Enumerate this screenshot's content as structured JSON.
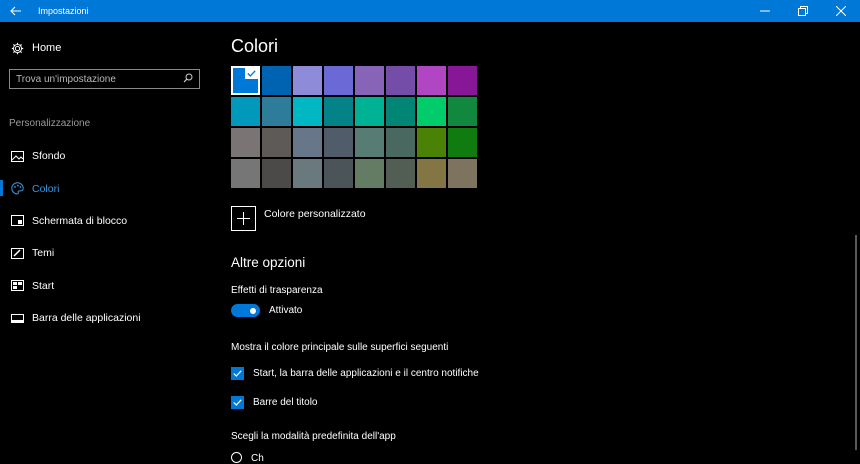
{
  "window": {
    "title": "Impostazioni"
  },
  "sidebar": {
    "home_label": "Home",
    "search_placeholder": "Trova un'impostazione",
    "section_label": "Personalizzazione",
    "items": [
      {
        "label": "Sfondo",
        "icon": "picture-icon",
        "active": false
      },
      {
        "label": "Colori",
        "icon": "palette-icon",
        "active": true
      },
      {
        "label": "Schermata di blocco",
        "icon": "lock-screen-icon",
        "active": false
      },
      {
        "label": "Temi",
        "icon": "brush-icon",
        "active": false
      },
      {
        "label": "Start",
        "icon": "start-icon",
        "active": false
      },
      {
        "label": "Barra delle applicazioni",
        "icon": "taskbar-icon",
        "active": false
      }
    ]
  },
  "main": {
    "title": "Colori",
    "swatches": [
      [
        "#0078d7",
        "#0063b1",
        "#8e8cd8",
        "#6b69d6",
        "#8764b8",
        "#744da9",
        "#b146c2",
        "#881798"
      ],
      [
        "#0099bc",
        "#2d7d9a",
        "#00b7c3",
        "#038387",
        "#00b294",
        "#018574",
        "#00cc6a",
        "#10893e"
      ],
      [
        "#7a7574",
        "#5d5a58",
        "#68768a",
        "#515c6b",
        "#567c73",
        "#486860",
        "#498205",
        "#107c10"
      ],
      [
        "#767676",
        "#4c4a48",
        "#69797e",
        "#4a5459",
        "#647c64",
        "#525e54",
        "#847545",
        "#7e735f"
      ]
    ],
    "selected_swatch": "#0078d7",
    "custom_color_label": "Colore personalizzato",
    "more_options_heading": "Altre opzioni",
    "transparency": {
      "label": "Effetti di trasparenza",
      "state_label": "Attivato",
      "on": true
    },
    "accent_surfaces": {
      "label": "Mostra il colore principale sulle superfici seguenti",
      "options": [
        {
          "label": "Start, la barra delle applicazioni e il centro notifiche",
          "checked": true
        },
        {
          "label": "Barre del titolo",
          "checked": true
        }
      ]
    },
    "app_mode": {
      "label": "Scegli la modalità predefinita dell'app",
      "first_option_peek": "Ch"
    }
  },
  "colors": {
    "accent": "#0078d7",
    "titlebar": "#0078d7",
    "background": "#000000"
  }
}
